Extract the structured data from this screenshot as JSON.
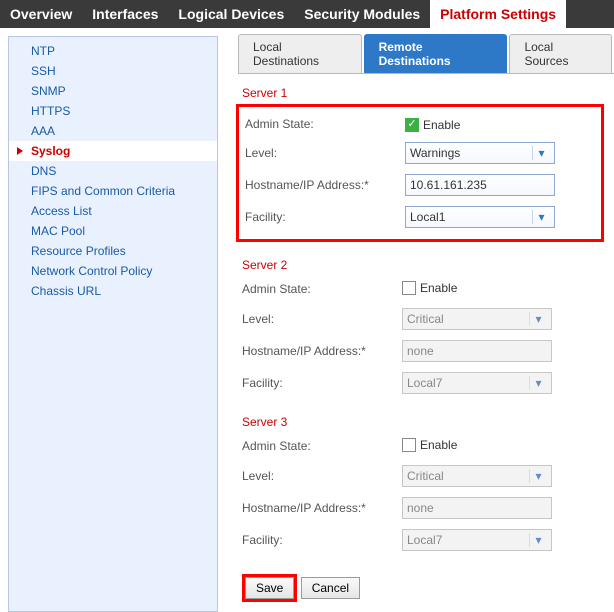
{
  "topnav": {
    "items": [
      "Overview",
      "Interfaces",
      "Logical Devices",
      "Security Modules",
      "Platform Settings"
    ],
    "active": 4
  },
  "sidebar": {
    "items": [
      "NTP",
      "SSH",
      "SNMP",
      "HTTPS",
      "AAA",
      "Syslog",
      "DNS",
      "FIPS and Common Criteria",
      "Access List",
      "MAC Pool",
      "Resource Profiles",
      "Network Control Policy",
      "Chassis URL"
    ],
    "active": 5
  },
  "subtabs": {
    "items": [
      "Local Destinations",
      "Remote Destinations",
      "Local Sources"
    ],
    "active": 1
  },
  "labels": {
    "admin_state": "Admin State:",
    "level": "Level:",
    "hostname": "Hostname/IP Address:*",
    "facility": "Facility:",
    "enable": "Enable"
  },
  "servers": [
    {
      "title": "Server 1",
      "enabled": true,
      "level": "Warnings",
      "hostname": "10.61.161.235",
      "facility": "Local1",
      "highlighted": true
    },
    {
      "title": "Server 2",
      "enabled": false,
      "level": "Critical",
      "hostname": "none",
      "facility": "Local7",
      "highlighted": false
    },
    {
      "title": "Server 3",
      "enabled": false,
      "level": "Critical",
      "hostname": "none",
      "facility": "Local7",
      "highlighted": false
    }
  ],
  "buttons": {
    "save": "Save",
    "cancel": "Cancel"
  }
}
